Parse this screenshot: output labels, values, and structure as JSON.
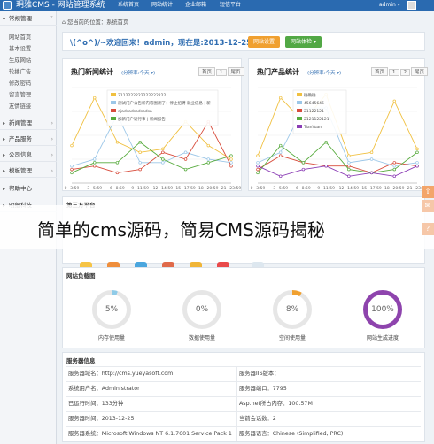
{
  "app": {
    "title": "玥雅CMS - 网站管理系统"
  },
  "top_nav": [
    "系统首页",
    "网站统计",
    "企业邮箱",
    "短信平台"
  ],
  "user": {
    "name": "admin ▾"
  },
  "sidebar": {
    "groups": [
      {
        "label": "常规管理",
        "items": [
          "网站首页",
          "基本设置",
          "生成网站",
          "轮播广告",
          "修改密码",
          "留言管理",
          "友情链接"
        ]
      },
      {
        "label": "新闻管理",
        "items": []
      },
      {
        "label": "产品服务",
        "items": []
      },
      {
        "label": "公司信息",
        "items": []
      },
      {
        "label": "模板管理",
        "items": []
      },
      {
        "label": "帮助中心",
        "items": []
      },
      {
        "label": "明细科技",
        "items": []
      }
    ]
  },
  "breadcrumb": "您当前的位置：系统首页",
  "welcome": {
    "text": "\\(^o^)/~欢迎回来！admin，现在是:2013-12-25 09:56",
    "btn_settings": "网站设置",
    "btn_maintain": "网站体检 ▾"
  },
  "news_chart": {
    "title": "热门新闻统计",
    "subtitle": "(分辨率:今天 ▾)",
    "pager": [
      "首页",
      "1",
      "尾页"
    ],
    "chart_data": {
      "type": "line",
      "title": "热门新闻统计",
      "categories": [
        "0~3:59",
        "3~5:59",
        "6~8:59",
        "9~11:59",
        "12~14:59",
        "15~17:59",
        "18~20:59",
        "21~23:59"
      ],
      "series": [
        {
          "name": "2112222222222222222",
          "color": "#f0c040",
          "values": [
            11,
            25,
            12,
            9,
            10,
            18,
            11,
            7
          ]
        },
        {
          "name": "测试门户公告新内容图测了：停止招聘 就业信息 | 新闻报告",
          "color": "#9cc7e8",
          "values": [
            5,
            7,
            20,
            6,
            6,
            9,
            7,
            6
          ]
        },
        {
          "name": "djadsadsadsadsa",
          "color": "#d84c3c",
          "values": [
            4,
            5,
            3,
            4,
            9,
            7,
            18,
            5
          ]
        },
        {
          "name": "加新门户近行事 | 新闻报告",
          "color": "#56aa3c",
          "values": [
            3,
            6,
            6,
            12,
            7,
            4,
            6,
            8
          ]
        }
      ],
      "ylim": [
        0,
        28
      ]
    }
  },
  "product_chart": {
    "title": "热门产品统计",
    "subtitle": "(分辨率:今天 ▾)",
    "pager": [
      "首页",
      "1",
      "2",
      "尾页"
    ],
    "chart_data": {
      "type": "line",
      "title": "热门产品统计",
      "categories": [
        "0~3:59",
        "3~5:59",
        "6~8:59",
        "9~11:59",
        "12~14:59",
        "15~17:59",
        "18~20:59",
        "21~23:59"
      ],
      "series": [
        {
          "name": "确确确",
          "color": "#f0c040",
          "values": [
            8,
            25,
            18,
            26,
            8,
            9,
            24,
            10
          ]
        },
        {
          "name": "45645646",
          "color": "#9cc7e8",
          "values": [
            6,
            9,
            22,
            22,
            6,
            7,
            5,
            6
          ]
        },
        {
          "name": "21122121",
          "color": "#d84c3c",
          "values": [
            4,
            8,
            6,
            5,
            5,
            3,
            6,
            5
          ]
        },
        {
          "name": "2121122121",
          "color": "#56aa3c",
          "values": [
            3,
            11,
            6,
            12,
            4,
            3,
            4,
            9
          ]
        },
        {
          "name": "TianYuan",
          "color": "#8b3db5",
          "values": [
            5,
            2,
            4,
            5,
            2,
            3,
            2,
            5
          ]
        }
      ],
      "ylim": [
        0,
        28
      ]
    }
  },
  "third_party": {
    "title": "第三方平台"
  },
  "overlay": {
    "text": "简单的cms源码，简易CMS源码揭秘"
  },
  "load": {
    "title": "网站负载图",
    "gauges": [
      {
        "value": "5%",
        "label": "内存使用量",
        "pct": 5,
        "color": "#8fcbe8"
      },
      {
        "value": "0%",
        "label": "数据使用量",
        "pct": 0,
        "color": "#8fcbe8"
      },
      {
        "value": "8%",
        "label": "空间使用量",
        "pct": 8,
        "color": "#f0a030"
      },
      {
        "value": "100%",
        "label": "网站生成进度",
        "pct": 100,
        "color": "#8e44ad"
      }
    ]
  },
  "server": {
    "title": "服务器信息",
    "rows": [
      [
        "服务器域名：http://cms.yueyasoft.com",
        "服务器IIS版本："
      ],
      [
        "系统用户名：Administrator",
        "服务器端口：7795"
      ],
      [
        "已运行时间：133分钟",
        "Asp.net所占内存：100.57M"
      ],
      [
        "服务器时间：2013-12-25",
        "当前会话数：2"
      ],
      [
        "服务器系统：Microsoft Windows NT 6.1.7601 Service Pack 1",
        "服务器语言：Chinese (Simplified, PRC)"
      ]
    ]
  }
}
